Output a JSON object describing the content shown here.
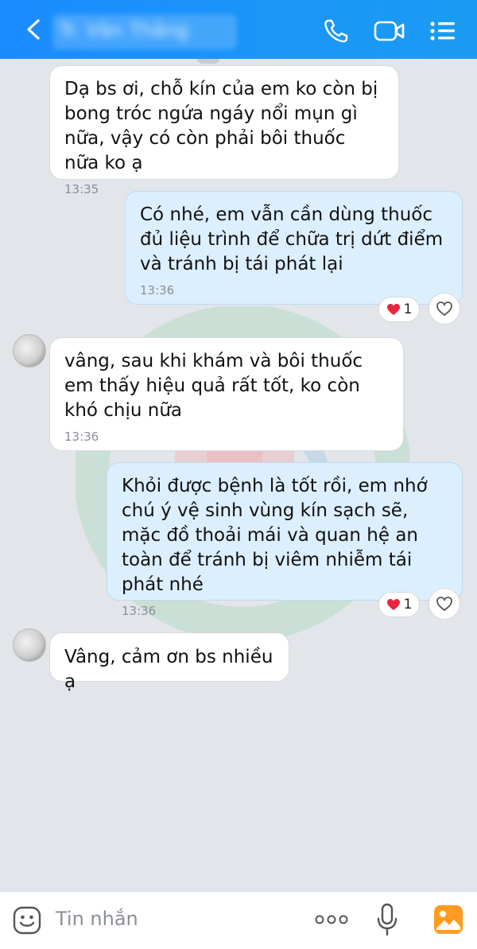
{
  "header": {
    "title": "Tr. Văn Thắng",
    "back_icon": "chevron-left-icon",
    "call_icon": "phone-icon",
    "video_icon": "video-camera-icon",
    "menu_icon": "list-menu-icon"
  },
  "messages": [
    {
      "side": "in",
      "text": "Dạ bs ơi, chỗ kín của em ko còn bị bong tróc ngứa ngáy nổi mụn gì nữa, vậy có còn phải bôi thuốc nữa ko ạ",
      "time": "13:35"
    },
    {
      "side": "out",
      "text": "Có nhé, em vẫn cần dùng thuốc đủ liệu trình để chữa trị dứt điểm và tránh bị tái phát lại",
      "time": "13:36",
      "reaction_count": "1"
    },
    {
      "side": "in",
      "text": "vâng, sau khi khám và bôi thuốc em thấy hiệu quả rất tốt, ko còn khó chịu nữa",
      "time": "13:36"
    },
    {
      "side": "out",
      "text": "Khỏi được bệnh là tốt rồi, em nhớ chú ý vệ sinh vùng kín sạch sẽ, mặc đồ thoải mái và quan hệ an toàn để tránh bị viêm nhiễm tái phát nhé",
      "time": "13:36",
      "reaction_count": "1"
    },
    {
      "side": "in",
      "text": "Vâng, cảm ơn bs nhiều ạ"
    }
  ],
  "composer": {
    "placeholder": "Tin nhắn",
    "emoji_icon": "emoji-icon",
    "more_icon": "more-dots-icon",
    "mic_icon": "microphone-icon",
    "image_icon": "image-icon"
  },
  "colors": {
    "header": "#1b8cff",
    "incoming_bubble": "#ffffff",
    "outgoing_bubble": "#dcefff",
    "background": "#e2e5ea",
    "reaction_heart": "#e8263f"
  }
}
